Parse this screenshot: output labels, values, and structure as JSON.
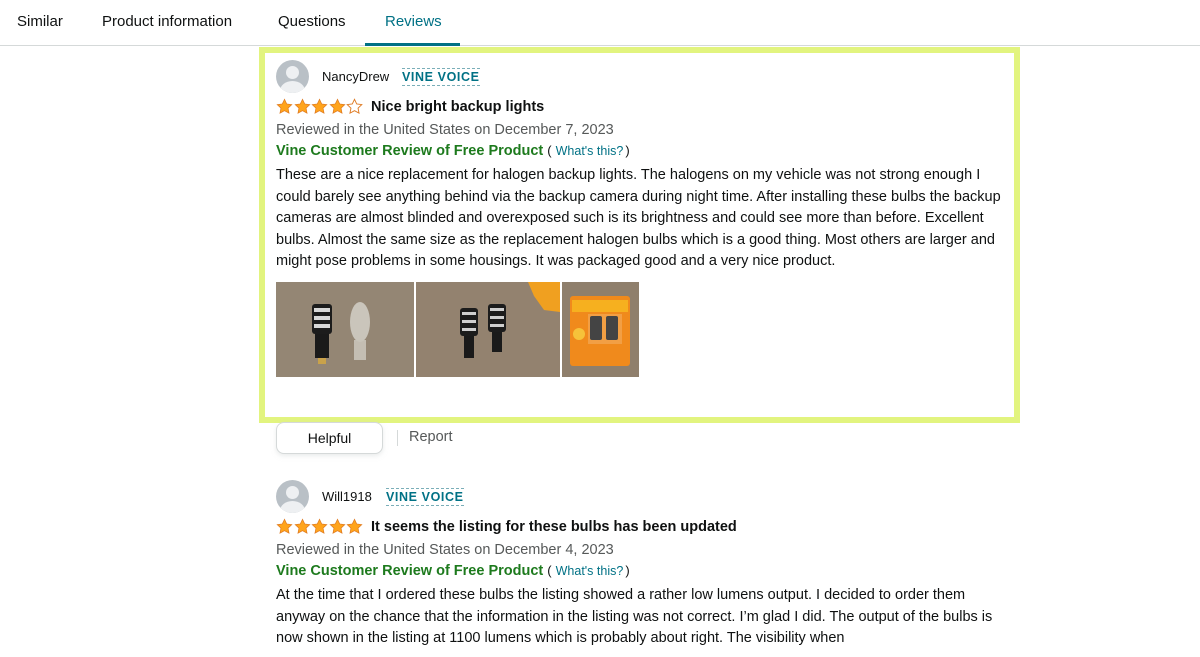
{
  "tabs": [
    {
      "label": "Similar",
      "active": false
    },
    {
      "label": "Product information",
      "active": false
    },
    {
      "label": "Questions",
      "active": false
    },
    {
      "label": "Reviews",
      "active": true
    }
  ],
  "colors": {
    "accent": "#007185",
    "star": "#ffa41c",
    "vine_green": "#1d7a1d",
    "highlight": "#e2f47f"
  },
  "reviews": [
    {
      "author": "NancyDrew",
      "badge": "VINE VOICE",
      "rating": 4,
      "rating_max": 5,
      "title": "Nice bright backup lights",
      "date": "Reviewed in the United States on December 7, 2023",
      "vine_label": "Vine Customer Review of Free Product",
      "paren_open": "(",
      "whats_this": "What's this?",
      "paren_close": ")",
      "body": "These are a nice replacement for halogen backup lights. The halogens on my vehicle was not strong enough I could barely see anything behind via the backup camera during night time. After installing these bulbs the backup cameras are almost blinded and overexposed such is its brightness and could see more than before. Excellent bulbs. Almost the same size as the replacement halogen bulbs which is a good thing. Most others are larger and might pose problems in some housings. It was packaged good and a very nice product.",
      "images": [
        "led-bulb-vs-halogen-photo",
        "two-led-bulbs-photo",
        "packaged-bulbs-photo"
      ],
      "helpful_label": "Helpful",
      "report_label": "Report"
    },
    {
      "author": "Will1918",
      "badge": "VINE VOICE",
      "rating": 5,
      "rating_max": 5,
      "title": "It seems the listing for these bulbs has been updated",
      "date": "Reviewed in the United States on December 4, 2023",
      "vine_label": "Vine Customer Review of Free Product",
      "paren_open": "(",
      "whats_this": "What's this?",
      "paren_close": ")",
      "body": "At the time that I ordered these bulbs the listing showed a rather low lumens output. I decided to order them anyway on the chance that the information in the listing was not correct. I’m glad I did. The output of the bulbs is now shown in the listing at 1100 lumens which is probably about right. The visibility when"
    }
  ]
}
